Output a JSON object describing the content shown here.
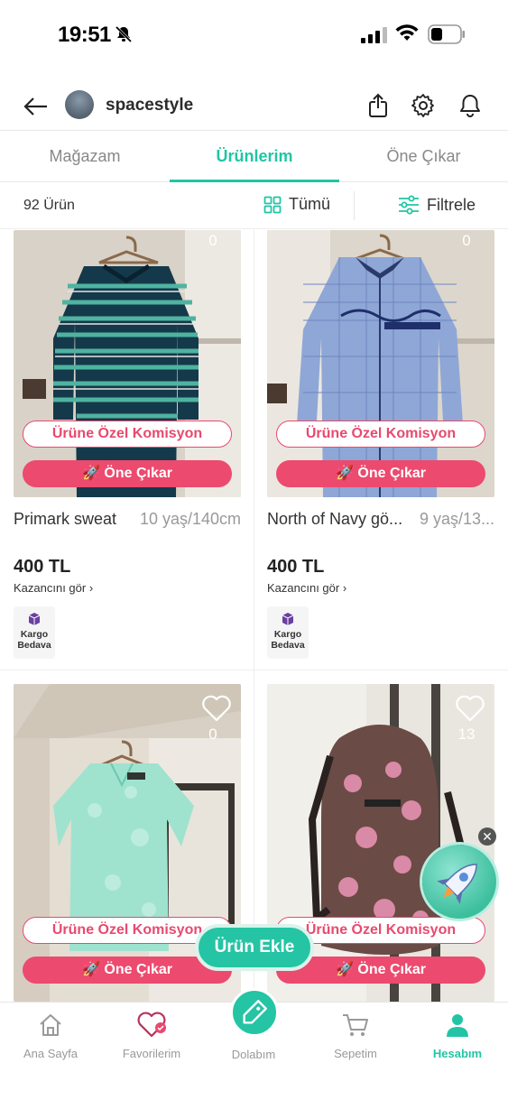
{
  "status_bar": {
    "time": "19:51"
  },
  "header": {
    "username": "spacestyle"
  },
  "tabs": [
    {
      "label": "Mağazam"
    },
    {
      "label": "Ürünlerim"
    },
    {
      "label": "Öne Çıkar"
    }
  ],
  "filter_bar": {
    "count": "92 Ürün",
    "view_label": "Tümü",
    "filter_label": "Filtrele"
  },
  "products": [
    {
      "likes": "0",
      "commission_label": "Ürüne Özel Komisyon",
      "boost_label": "Öne Çıkar",
      "title": "Primark sweat",
      "size": "10 yaş/140cm",
      "price": "400 TL",
      "earn_label": "Kazancını gör",
      "cargo": [
        "Kargo",
        "Bedava"
      ]
    },
    {
      "likes": "0",
      "commission_label": "Ürüne Özel Komisyon",
      "boost_label": "Öne Çıkar",
      "title": "North of Navy gö...",
      "size": "9 yaş/13...",
      "price": "400 TL",
      "earn_label": "Kazancını gör",
      "cargo": [
        "Kargo",
        "Bedava"
      ]
    },
    {
      "likes": "0",
      "commission_label": "Ürüne Özel Komisyon",
      "boost_label": "Öne Çıkar"
    },
    {
      "likes": "13",
      "commission_label": "Ürüne Özel Komisyon",
      "boost_label": "Öne Çıkar"
    }
  ],
  "floating": {
    "add_label": "Ürün Ekle",
    "close": "✕"
  },
  "bottom_nav": [
    {
      "label": "Ana Sayfa"
    },
    {
      "label": "Favorilerim"
    },
    {
      "label": "Dolabım"
    },
    {
      "label": "Sepetim"
    },
    {
      "label": "Hesabım"
    }
  ],
  "colors": {
    "accent": "#21c5a5",
    "pink": "#ec4a6e"
  }
}
